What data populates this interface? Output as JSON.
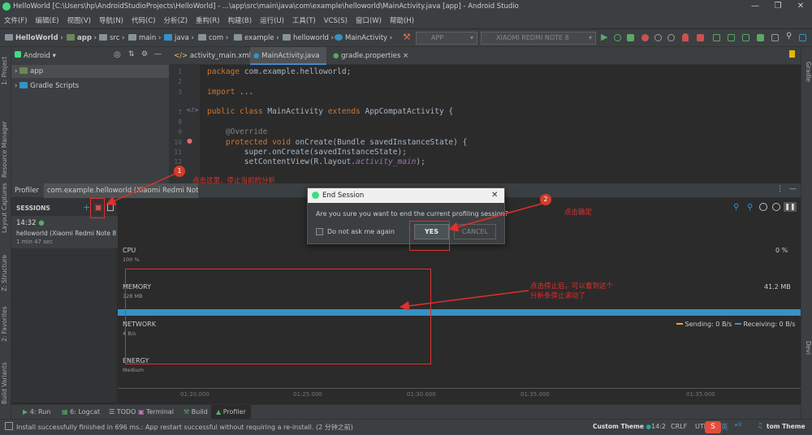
{
  "window": {
    "title": "HelloWorld [C:\\Users\\hp\\AndroidStudioProjects\\HelloWorld] - ...\\app\\src\\main\\java\\com\\example\\helloworld\\MainActivity.java [app] - Android Studio"
  },
  "menu": [
    "文件(F)",
    "编辑(E)",
    "视图(V)",
    "导航(N)",
    "代码(C)",
    "分析(Z)",
    "重构(R)",
    "构建(B)",
    "运行(U)",
    "工具(T)",
    "VCS(S)",
    "窗口(W)",
    "帮助(H)"
  ],
  "breadcrumb": [
    "HelloWorld",
    "app",
    "src",
    "main",
    "java",
    "com",
    "example",
    "helloworld",
    "MainActivity"
  ],
  "toolbar": {
    "app_config": "APP",
    "device": "XIAOMI REDMI NOTE 8"
  },
  "left_tabs": [
    "1: Project",
    "Resource Manager",
    "Layout Captures",
    "Z: Structure",
    "2: Favorites",
    "Build Variants"
  ],
  "right_tabs": [
    "Gradle",
    "Devi"
  ],
  "project": {
    "view": "Android",
    "items": [
      "app",
      "Gradle Scripts"
    ]
  },
  "editor": {
    "tabs": [
      {
        "label": "activity_main.xml"
      },
      {
        "label": "MainActivity.java"
      },
      {
        "label": "gradle.properties"
      }
    ],
    "line_numbers": [
      "1",
      "2",
      "3",
      "",
      "7",
      "8",
      "9",
      "10",
      "11",
      "12",
      "13"
    ],
    "code": {
      "l1_kw": "package",
      "l1_rest": " com.example.helloworld;",
      "l3_kw": "import",
      "l3_rest": " ...",
      "l7_kw": "public class",
      "l7_name": " MainActivity ",
      "l7_kw2": "extends",
      "l7_rest": " AppCompatActivity {",
      "l9": "    @Override",
      "l10_kw": "    protected void",
      "l10_rest": " onCreate(Bundle savedInstanceState) {",
      "l11": "        super.onCreate(savedInstanceState);",
      "l12_a": "        setContentView(R.layout.",
      "l12_b": "activity_main",
      "l12_c": ");"
    }
  },
  "profiler": {
    "title": "Profiler",
    "session_tab": "com.example.helloworld (Xiaomi Redmi Note ...",
    "sessions_label": "SESSIONS",
    "session_time": "14:32",
    "session_name": "helloworld (Xiaomi Redmi Note 8...",
    "session_duration": "1 min 47 sec",
    "cpu_label": "CPU",
    "cpu_scale": "100 %",
    "cpu_value": "0 %",
    "memory_label": "MEMORY",
    "memory_scale": "128 MB",
    "memory_value": "41.2 MB",
    "network_label": "NETWORK",
    "network_scale": "4 B/s",
    "sending": "Sending: 0 B/s",
    "receiving": "Receiving: 0 B/s",
    "energy_label": "ENERGY",
    "energy_scale": "Medium",
    "ticks": [
      "01:20.000",
      "01:25.000",
      "01:30.000",
      "01:35.000",
      "01:35.000"
    ]
  },
  "dialog": {
    "title": "End Session",
    "message": "Are you sure you want to end the current profiling session?",
    "checkbox": "Do not ask me again",
    "yes": "YES",
    "cancel": "CANCEL"
  },
  "annotations": {
    "badge1": "1",
    "text1": "点击这里，停止当前的分析",
    "badge2": "2",
    "text2": "点击确定",
    "text3a": "点击停止后，可以看到这个",
    "text3b": "分析条停止滚动了"
  },
  "bottom_tabs": [
    "4: Run",
    "6: Logcat",
    "TODO",
    "Terminal",
    "Build",
    "Profiler"
  ],
  "status": {
    "message": "Install successfully finished in 696 ms.: App restart successful without requiring a re-install. (2 分钟之前)",
    "theme": "Custom Theme",
    "position": "14:2",
    "line_sep": "CRLF",
    "encoding": "UTI",
    "ime": "英",
    "theme2": "tom Theme"
  },
  "colors": {
    "accent": "#3592c4",
    "red": "#e0302d",
    "bg": "#2b2b2b",
    "panel": "#3c3f41"
  }
}
